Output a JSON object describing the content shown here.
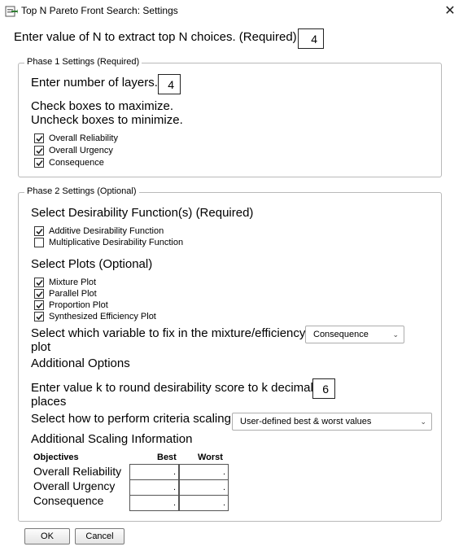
{
  "window": {
    "title": "Top N Pareto Front Search: Settings",
    "close_glyph": "✕",
    "icon": "jmp-addin-icon"
  },
  "top_n": {
    "prompt": "Enter value of N to extract top N choices. (Required)",
    "value": "4"
  },
  "phase1": {
    "legend": "Phase 1 Settings (Required)",
    "layers_prompt": "Enter number of layers.",
    "layers_value": "4",
    "instruction1": "Check boxes to maximize.",
    "instruction2": "Uncheck boxes to minimize.",
    "objectives": [
      {
        "label": "Overall Reliability",
        "checked": true
      },
      {
        "label": "Overall Urgency",
        "checked": true
      },
      {
        "label": "Consequence",
        "checked": true
      }
    ]
  },
  "phase2": {
    "legend": "Phase 2 Settings (Optional)",
    "desirability_heading": "Select Desirability Function(s) (Required)",
    "desirability_options": [
      {
        "label": "Additive Desirability Function",
        "checked": true
      },
      {
        "label": "Multiplicative Desirability Function",
        "checked": false
      }
    ],
    "plots_heading": "Select Plots (Optional)",
    "plot_options": [
      {
        "label": "Mixture Plot",
        "checked": true
      },
      {
        "label": "Parallel Plot",
        "checked": true
      },
      {
        "label": "Proportion Plot",
        "checked": true
      },
      {
        "label": "Synthesized Efficiency Plot",
        "checked": true
      }
    ],
    "fix_variable_line1": "Select which variable to fix in the mixture/efficiency",
    "fix_variable_line2": "plot",
    "fix_variable_value": "Consequence",
    "additional_options": "Additional Options",
    "round_line1": "Enter value k to round desirability score to k decimal",
    "round_line2": "places",
    "round_value": "6",
    "scaling_prompt": "Select how to perform criteria scaling",
    "scaling_value": "User-defined best & worst values",
    "scaling_info_heading": "Additional Scaling Information",
    "table": {
      "headers": [
        "Objectives",
        "Best",
        "Worst"
      ],
      "rows": [
        {
          "objective": "Overall Reliability",
          "best": ".",
          "worst": "."
        },
        {
          "objective": "Overall Urgency",
          "best": ".",
          "worst": "."
        },
        {
          "objective": "Consequence",
          "best": ".",
          "worst": "."
        }
      ]
    }
  },
  "buttons": {
    "ok": "OK",
    "cancel": "Cancel"
  },
  "colors": {
    "border": "#b9b9b9",
    "check": "#222222",
    "icon_accent": "#2f7d32"
  }
}
